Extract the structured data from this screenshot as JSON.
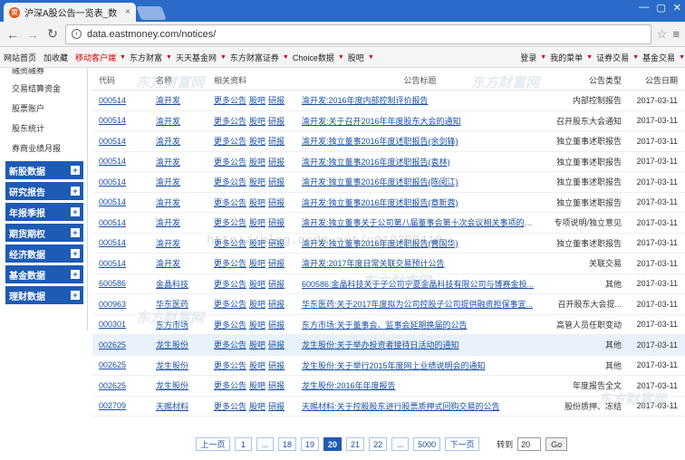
{
  "browser": {
    "tab_title": "沪深A股公告一览表_数",
    "tab_close": "×",
    "address": "data.eastmoney.com/notices/",
    "win_controls": [
      "—",
      "▢",
      "✕"
    ]
  },
  "site_nav": [
    {
      "label": "网站首页",
      "red": false,
      "caret": false
    },
    {
      "label": "加收藏",
      "red": false,
      "caret": false
    },
    {
      "label": "移动客户端",
      "red": true,
      "caret": true
    },
    {
      "label": "东方财富",
      "red": false,
      "caret": true
    },
    {
      "label": "天天基金网",
      "red": false,
      "caret": true
    },
    {
      "label": "东方财富证券",
      "red": false,
      "caret": true
    },
    {
      "label": "Choice数据",
      "red": false,
      "caret": true
    },
    {
      "label": "股吧",
      "red": false,
      "caret": true
    },
    {
      "label": "登录",
      "red": false,
      "caret": true
    },
    {
      "label": "我的菜单",
      "red": false,
      "caret": true
    },
    {
      "label": "证券交易",
      "red": false,
      "caret": true
    },
    {
      "label": "基金交易",
      "red": false,
      "caret": true
    }
  ],
  "sidebar": {
    "links": [
      "融资融券",
      "交易结算资金",
      "股票账户",
      "股东统计",
      "券商业绩月报"
    ],
    "categories": [
      "新股数据",
      "研究报告",
      "年报季报",
      "期货期权",
      "经济数据",
      "基金数据",
      "理财数据"
    ],
    "plus": "+"
  },
  "table": {
    "headers": {
      "code": "代码",
      "name": "名称",
      "related": "相关资料",
      "title": "公告标题",
      "type": "公告类型",
      "date": "公告日期"
    },
    "related_links": [
      "更多公告",
      "股吧",
      "研报"
    ],
    "rows": [
      {
        "code": "000514",
        "name": "渝开发",
        "title": "渝开发:2016年度内部控制评价报告",
        "type": "内部控制报告",
        "date": "2017-03-11"
      },
      {
        "code": "000514",
        "name": "渝开发",
        "title": "渝开发:关于召开2016年年度股东大会的通知",
        "type": "召开股东大会通知",
        "date": "2017-03-11"
      },
      {
        "code": "000514",
        "name": "渝开发",
        "title": "渝开发:独立董事2016年度述职报告(余剑锋)",
        "type": "独立董事述职报告",
        "date": "2017-03-11"
      },
      {
        "code": "000514",
        "name": "渝开发",
        "title": "渝开发:独立董事2016年度述职报告(袁林)",
        "type": "独立董事述职报告",
        "date": "2017-03-11"
      },
      {
        "code": "000514",
        "name": "渝开发",
        "title": "渝开发:独立董事2016年度述职报告(陈阅江)",
        "type": "独立董事述职报告",
        "date": "2017-03-11"
      },
      {
        "code": "000514",
        "name": "渝开发",
        "title": "渝开发:独立董事2016年度述职报告(章新蓉)",
        "type": "独立董事述职报告",
        "date": "2017-03-11"
      },
      {
        "code": "000514",
        "name": "渝开发",
        "title": "渝开发:独立董事关于公司第八届董事会第十次会议相关事项的独...",
        "type": "专项说明/独立意见",
        "date": "2017-03-11"
      },
      {
        "code": "000514",
        "name": "渝开发",
        "title": "渝开发:独立董事2016年度述职报告(曹国华)",
        "type": "独立董事述职报告",
        "date": "2017-03-11"
      },
      {
        "code": "000514",
        "name": "渝开发",
        "title": "渝开发:2017年度日常关联交易预计公告",
        "type": "关联交易",
        "date": "2017-03-11"
      },
      {
        "code": "600586",
        "name": "金晶科技",
        "title": "600586:金晶科技关于子公司宁夏金晶科技有限公司与博赛金投...",
        "type": "其他",
        "date": "2017-03-11"
      },
      {
        "code": "000963",
        "name": "华东医药",
        "title": "华东医药:关于2017年度拟为公司控股子公司提供融资担保事宜...",
        "type": "召开股东大会提...",
        "date": "2017-03-11"
      },
      {
        "code": "000301",
        "name": "东方市场",
        "title": "东方市场:关于董事会、监事会延期换届的公告",
        "type": "高管人员任职变动",
        "date": "2017-03-11"
      },
      {
        "code": "002625",
        "name": "龙生股份",
        "title": "龙生股份:关于举办投资者接待日活动的通知",
        "type": "其他",
        "date": "2017-03-11"
      },
      {
        "code": "002625",
        "name": "龙生股份",
        "title": "龙生股份:关于举行2015年度网上业绩说明会的通知",
        "type": "其他",
        "date": "2017-03-11"
      },
      {
        "code": "002625",
        "name": "龙生股份",
        "title": "龙生股份:2016年年度报告",
        "type": "年度报告全文",
        "date": "2017-03-11"
      },
      {
        "code": "002709",
        "name": "天赐材料",
        "title": "天赐材料:关于控股股东进行股票质押式回购交易的公告",
        "type": "股份质押、冻结",
        "date": "2017-03-11"
      }
    ]
  },
  "pager": {
    "prev": "上一页",
    "pages": [
      "1",
      "...",
      "18",
      "19",
      "20",
      "21",
      "22",
      "...",
      "5000"
    ],
    "current": "20",
    "next": "下一页",
    "goto_label": "转到",
    "goto_value": "20",
    "go": "Go"
  },
  "watermark": {
    "brand": "东方财富网",
    "url": "http://blog.csdn.net/u012350410"
  }
}
